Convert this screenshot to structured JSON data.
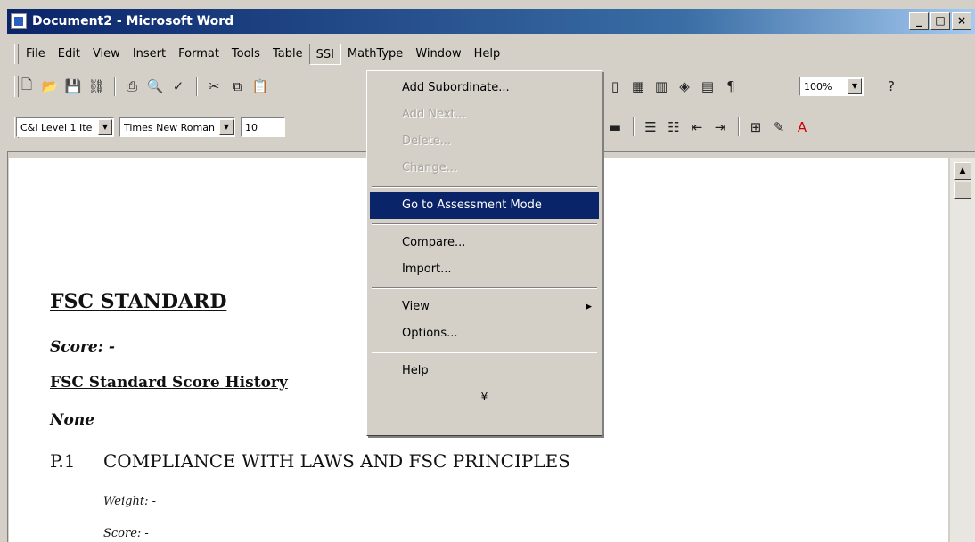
{
  "window": {
    "title": "Document2 - Microsoft Word",
    "buttons": [
      "_",
      "□",
      "×"
    ]
  },
  "menubar": {
    "items": [
      "File",
      "Edit",
      "View",
      "Insert",
      "Format",
      "Tools",
      "Table",
      "SSI",
      "MathType",
      "Window",
      "Help"
    ],
    "active": "SSI"
  },
  "toolbar_formatting": {
    "style_value": "C&I Level 1 Ite",
    "font_value": "Times New Roman",
    "size_value": "10",
    "zoom_value": "100%"
  },
  "ssi_menu": {
    "items": [
      {
        "label": "Add Subordinate...",
        "state": "enabled"
      },
      {
        "label": "Add Next...",
        "state": "disabled"
      },
      {
        "label": "Delete...",
        "state": "disabled"
      },
      {
        "label": "Change...",
        "state": "disabled"
      },
      {
        "label": "Go to Assessment Mode",
        "state": "highlighted"
      },
      {
        "label": "Compare...",
        "state": "enabled"
      },
      {
        "label": "Import...",
        "state": "enabled"
      },
      {
        "label": "View",
        "state": "enabled"
      },
      {
        "label": "Options...",
        "state": "enabled"
      },
      {
        "label": "Help",
        "state": "enabled"
      }
    ],
    "expand_glyph": "¥"
  },
  "document": {
    "heading": "FSC STANDARD",
    "score_label": "Score: -",
    "history_heading": "FSC Standard Score History",
    "history_value": "None",
    "principle_number": "P.1",
    "principle_title": "COMPLIANCE WITH LAWS AND FSC PRINCIPLES",
    "weight_label": "Weight: -",
    "principle_score": "Score: -"
  },
  "colors": {
    "titlebar": "#0a246a",
    "menu_highlight": "#0a246a",
    "chrome": "#d4d0c8"
  }
}
